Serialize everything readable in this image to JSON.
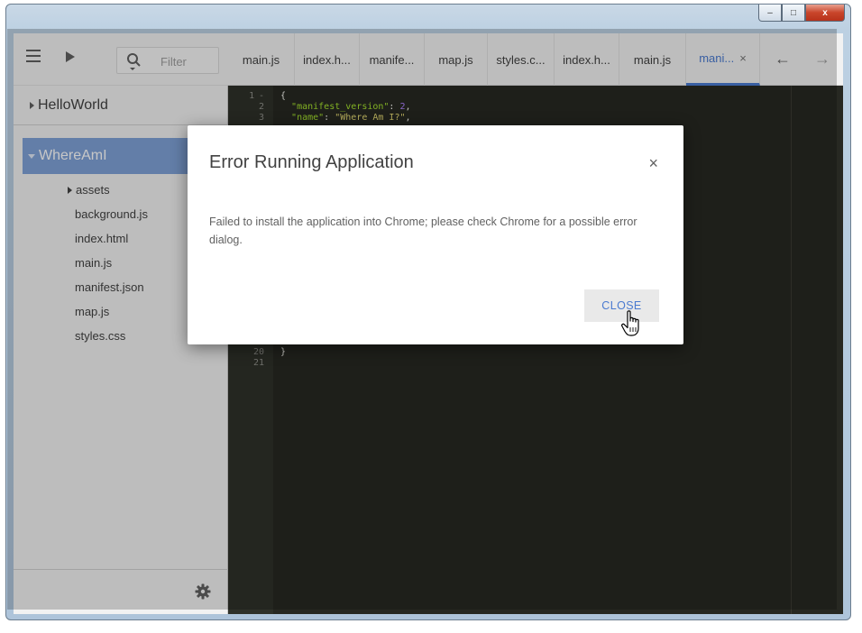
{
  "window": {
    "controls": {
      "minimize": "–",
      "maximize": "□",
      "close": "x"
    }
  },
  "sidebar": {
    "filter_placeholder": "Filter",
    "projects": [
      {
        "label": "HelloWorld",
        "expanded": false
      },
      {
        "label": "WhereAmI",
        "expanded": true,
        "selected": true
      }
    ],
    "files": [
      "assets",
      "background.js",
      "index.html",
      "main.js",
      "manifest.json",
      "map.js",
      "styles.css"
    ],
    "settings_icon": "gear-icon"
  },
  "tabs": [
    {
      "label": "main.js",
      "active": false
    },
    {
      "label": "index.h...",
      "active": false
    },
    {
      "label": "manife...",
      "active": false
    },
    {
      "label": "map.js",
      "active": false
    },
    {
      "label": "styles.c...",
      "active": false
    },
    {
      "label": "index.h...",
      "active": false
    },
    {
      "label": "main.js",
      "active": false
    },
    {
      "label": "mani...",
      "active": true,
      "close": "×"
    }
  ],
  "nav": {
    "back": "←",
    "forward": "→"
  },
  "editor": {
    "lines": [
      {
        "n": "1",
        "fold": "-",
        "text": "{"
      },
      {
        "n": "2",
        "key": "\"manifest_version\"",
        "sep": ": ",
        "val": "2",
        "tail": ","
      },
      {
        "n": "3",
        "key": "\"name\"",
        "sep": ": ",
        "val": "\"Where Am I?\"",
        "tail": ","
      }
    ],
    "after": [
      {
        "n": "20",
        "text": "}"
      },
      {
        "n": "21",
        "text": ""
      }
    ]
  },
  "dialog": {
    "title": "Error Running Application",
    "close_symbol": "×",
    "message": "Failed to install the application into Chrome; please check Chrome for a possible error dialog.",
    "button_label": "CLOSE"
  },
  "colors": {
    "accent": "#4a7ad0",
    "selection": "#7fa2d8",
    "editor_bg": "#272822"
  }
}
